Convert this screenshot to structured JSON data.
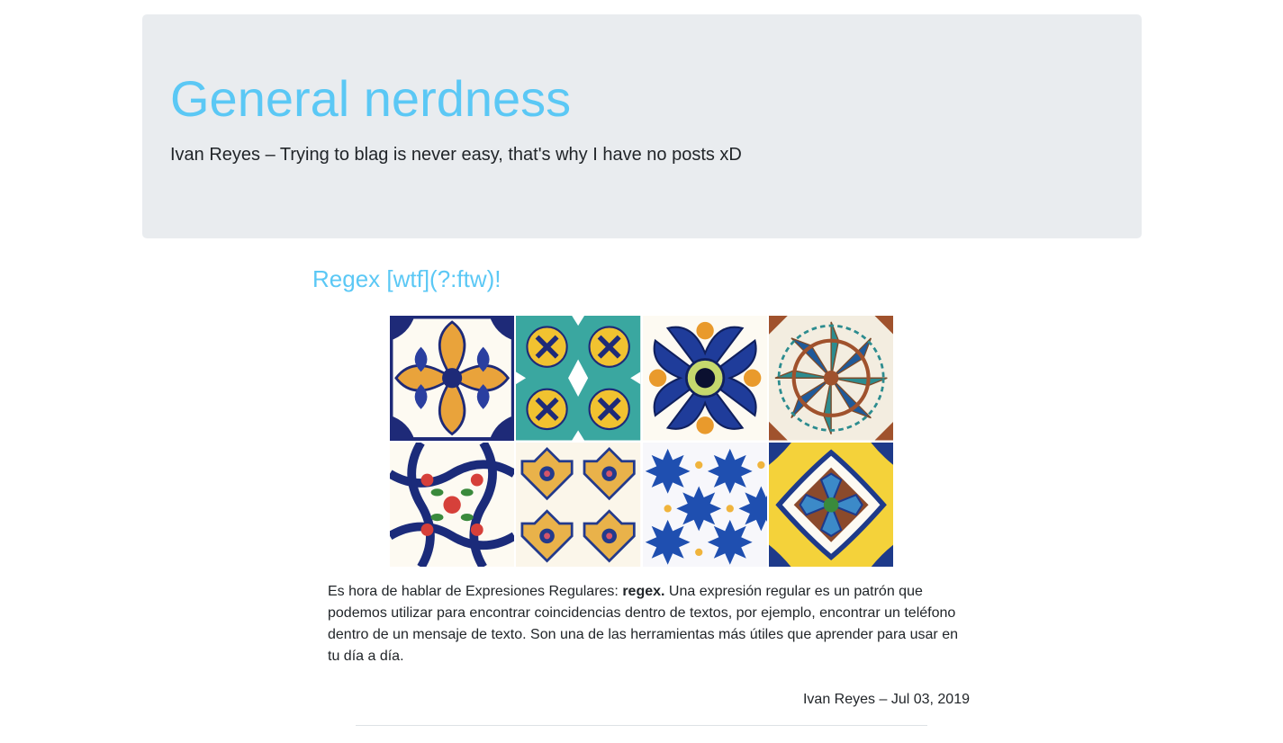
{
  "header": {
    "title": "General nerdness",
    "lead": "Ivan Reyes – Trying to blag is never easy, that's why I have no posts xD"
  },
  "post": {
    "title": "Regex [wtf](?:ftw)!",
    "excerpt_intro": "Es hora de hablar de Expresiones Regulares: ",
    "excerpt_bold": "regex.",
    "excerpt_rest": " Una expresión regular es un patrón que podemos utilizar para encontrar coincidencias dentro de textos, por ejemplo, encontrar un teléfono dentro de un mensaje de texto. Son una de las herramientas más útiles que aprender para usar en tu día a día.",
    "meta": "Ivan Reyes – Jul 03, 2019"
  },
  "colors": {
    "accent": "#5bc8f5",
    "jumbotron_bg": "#e9ecef",
    "text": "#212529"
  }
}
